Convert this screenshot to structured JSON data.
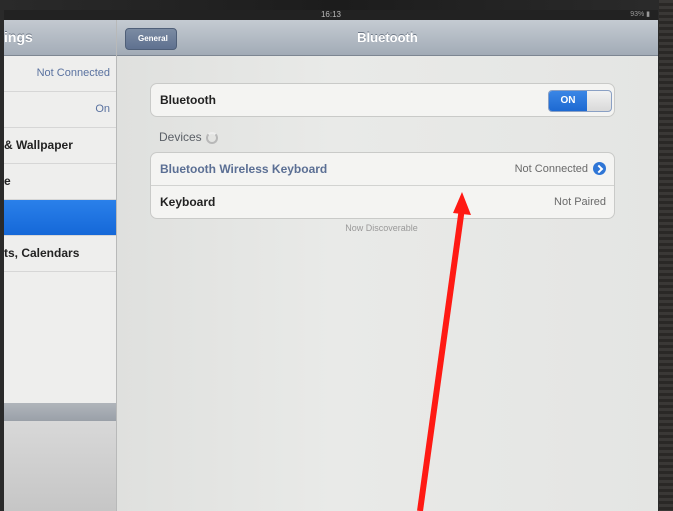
{
  "status_bar": {
    "time": "16:13",
    "right": "93% ▮"
  },
  "sidebar": {
    "title": "ings",
    "items": [
      {
        "label": "",
        "value": "Not Connected"
      },
      {
        "label": "",
        "value": "On"
      },
      {
        "label": "& Wallpaper",
        "value": ""
      },
      {
        "label": "e",
        "value": ""
      },
      {
        "label": "",
        "value": "",
        "selected": true
      },
      {
        "label": "ts, Calendars",
        "value": ""
      }
    ]
  },
  "navbar": {
    "back_label": "General",
    "title": "Bluetooth"
  },
  "bluetooth": {
    "label": "Bluetooth",
    "toggle": "ON"
  },
  "devices": {
    "section_label": "Devices",
    "items": [
      {
        "name": "Bluetooth Wireless Keyboard",
        "status": "Not Connected"
      },
      {
        "name": "Keyboard",
        "status": "Not Paired"
      }
    ],
    "footnote": "Now Discoverable"
  },
  "colors": {
    "accent": "#1d69d2",
    "arrow": "#ff1a14"
  }
}
